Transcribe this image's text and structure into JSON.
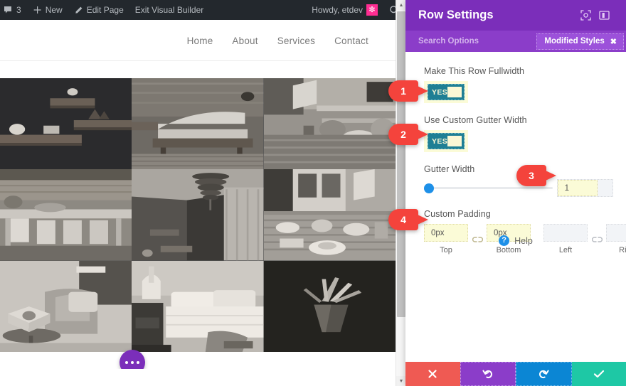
{
  "adminbar": {
    "comments_icon": "comment-icon",
    "comments_count": "3",
    "new_icon": "plus-icon",
    "new_label": "New",
    "edit_icon": "pencil-icon",
    "edit_label": "Edit Page",
    "exit_label": "Exit Visual Builder",
    "howdy": "Howdy, etdev",
    "avatar_icon": "avatar-icon",
    "search_icon": "search-icon",
    "bg_color": "#23282d",
    "avatar_color": "#ff2d92"
  },
  "site": {
    "nav": [
      {
        "label": "Home"
      },
      {
        "label": "About"
      },
      {
        "label": "Services"
      },
      {
        "label": "Contact"
      }
    ],
    "gallery": {
      "tiles": [
        {
          "name": "dark-shelves-photo"
        },
        {
          "name": "bedroom-bed-photo"
        },
        {
          "name": "patio-table-closeup-photo"
        },
        {
          "name": "outdoor-dining-table-photo"
        },
        {
          "name": "pendant-lamp-room-photo"
        },
        {
          "name": "breakfast-table-photo"
        },
        {
          "name": "living-room-armchair-photo"
        },
        {
          "name": "bedroom-nightstand-photo"
        },
        {
          "name": "dark-plant-vase-photo"
        }
      ]
    },
    "dots_button_icon": "ellipsis-icon",
    "dots_button_color": "#7b2eba"
  },
  "scrollbar": {
    "up_arrow": "▲",
    "down_arrow": "▼"
  },
  "panel": {
    "title": "Row Settings",
    "header_color": "#7b2eba",
    "icons": [
      {
        "name": "focus-icon"
      },
      {
        "name": "panel-layout-icon"
      }
    ],
    "search_placeholder": "Search Options",
    "modified_badge": {
      "label": "Modified Styles",
      "close": "✖",
      "color": "#9c51da"
    },
    "fields": {
      "fullwidth": {
        "label": "Make This Row Fullwidth",
        "toggle_value": "YES"
      },
      "gutter_toggle": {
        "label": "Use Custom Gutter Width",
        "toggle_value": "YES"
      },
      "gutter_width": {
        "label": "Gutter Width",
        "value": "1"
      },
      "custom_padding": {
        "label": "Custom Padding",
        "link_icon": "broken-link-icon",
        "cells": [
          {
            "value": "0px",
            "caption": "Top",
            "filled": true
          },
          {
            "value": "0px",
            "caption": "Bottom",
            "filled": true
          },
          {
            "value": "",
            "caption": "Left",
            "filled": false
          },
          {
            "value": "",
            "caption": "Right",
            "filled": false
          }
        ]
      }
    },
    "help": {
      "icon": "question-mark-icon",
      "label": "Help"
    },
    "actions": [
      {
        "name": "cancel-button",
        "icon": "close-icon",
        "color": "#ef5a53"
      },
      {
        "name": "undo-button",
        "icon": "undo-icon",
        "color": "#8b3dc9"
      },
      {
        "name": "redo-button",
        "icon": "redo-icon",
        "color": "#0b86d4"
      },
      {
        "name": "save-button",
        "icon": "check-icon",
        "color": "#1ec8a5"
      }
    ]
  },
  "callouts": [
    {
      "number": "1"
    },
    {
      "number": "2"
    },
    {
      "number": "3"
    },
    {
      "number": "4"
    }
  ]
}
